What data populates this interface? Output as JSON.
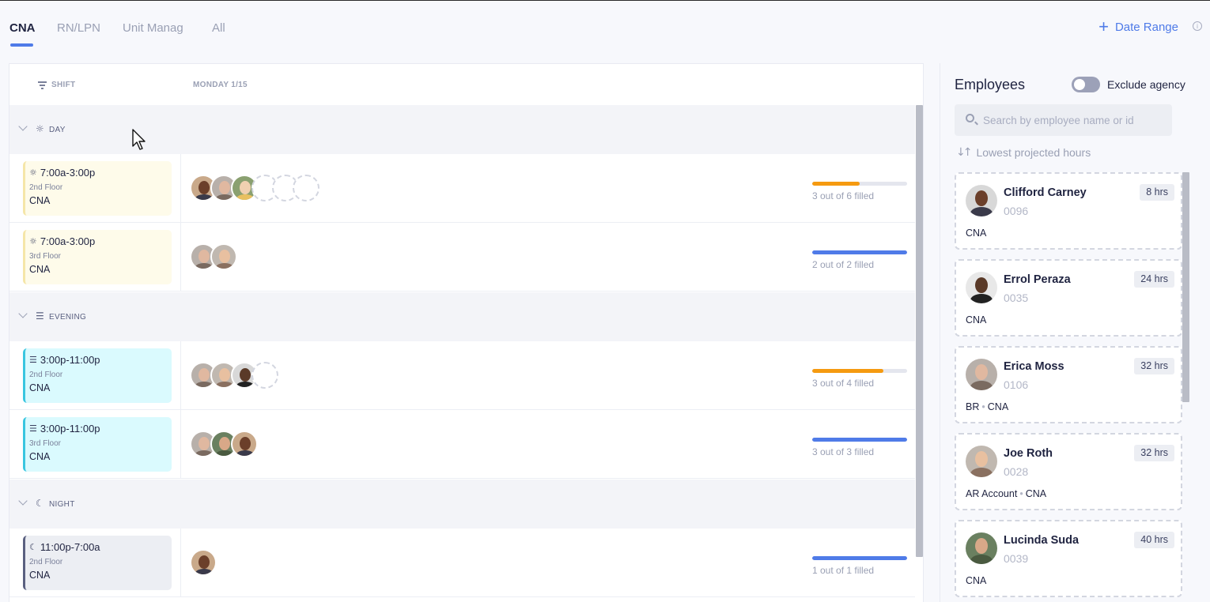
{
  "tabs": [
    {
      "label": "CNA",
      "active": true
    },
    {
      "label": "RN/LPN",
      "active": false
    },
    {
      "label": "Unit Manag",
      "active": false
    },
    {
      "label": "All",
      "active": false
    }
  ],
  "toolbar": {
    "date_range_label": "Date Range",
    "plus_icon": "plus-icon",
    "info_icon": "info-icon"
  },
  "schedule": {
    "shift_header": "SHIFT",
    "day_header": "MONDAY 1/15",
    "groups": [
      {
        "label": "DAY",
        "icon": "sun-icon",
        "shifts": [
          {
            "time": "7:00a-3:00p",
            "floor": "2nd Floor",
            "role": "CNA",
            "filled": 3,
            "total": 6,
            "fill_text": "3 out of 6 filled",
            "bar_color": "#f59a10"
          },
          {
            "time": "7:00a-3:00p",
            "floor": "3rd Floor",
            "role": "CNA",
            "filled": 2,
            "total": 2,
            "fill_text": "2 out of 2 filled",
            "bar_color": "#4f7be8"
          }
        ]
      },
      {
        "label": "EVENING",
        "icon": "sunset-icon",
        "shifts": [
          {
            "time": "3:00p-11:00p",
            "floor": "2nd Floor",
            "role": "CNA",
            "filled": 3,
            "total": 4,
            "fill_text": "3 out of 4 filled",
            "bar_color": "#f59a10"
          },
          {
            "time": "3:00p-11:00p",
            "floor": "3rd Floor",
            "role": "CNA",
            "filled": 3,
            "total": 3,
            "fill_text": "3 out of 3 filled",
            "bar_color": "#4f7be8"
          }
        ]
      },
      {
        "label": "NIGHT",
        "icon": "moon-icon",
        "shifts": [
          {
            "time": "11:00p-7:00a",
            "floor": "2nd Floor",
            "role": "CNA",
            "filled": 1,
            "total": 1,
            "fill_text": "1 out of 1 filled",
            "bar_color": "#4f7be8"
          }
        ]
      }
    ]
  },
  "employees": {
    "title": "Employees",
    "exclude_agency_label": "Exclude agency",
    "search_placeholder": "Search by employee name or id",
    "sort_label": "Lowest projected hours",
    "list": [
      {
        "name": "Clifford Carney",
        "id": "0096",
        "hours": "8 hrs",
        "roles": [
          "CNA"
        ]
      },
      {
        "name": "Errol Peraza",
        "id": "0035",
        "hours": "24 hrs",
        "roles": [
          "CNA"
        ]
      },
      {
        "name": "Erica Moss",
        "id": "0106",
        "hours": "32 hrs",
        "roles": [
          "BR",
          "CNA"
        ]
      },
      {
        "name": "Joe Roth",
        "id": "0028",
        "hours": "32 hrs",
        "roles": [
          "AR Account",
          "CNA"
        ]
      },
      {
        "name": "Lucinda Suda",
        "id": "0039",
        "hours": "40 hrs",
        "roles": [
          "CNA"
        ]
      }
    ]
  }
}
